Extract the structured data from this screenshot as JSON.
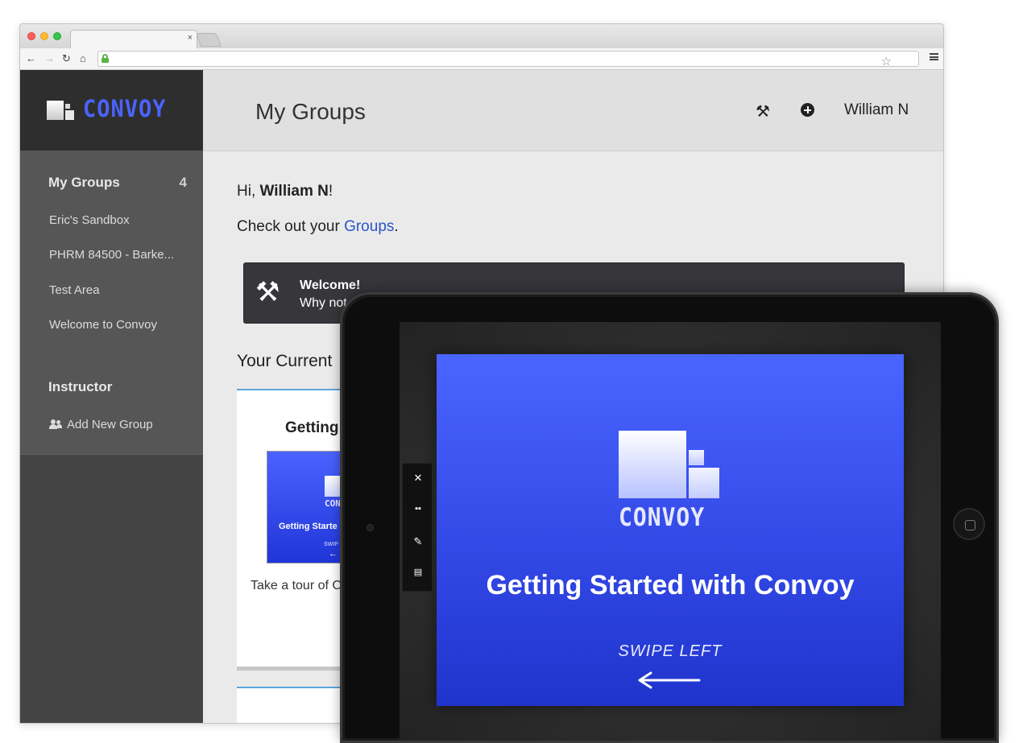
{
  "browser": {
    "tab_close": "×",
    "nav": {
      "back": "←",
      "forward": "→",
      "reload": "↻",
      "home": "⌂"
    },
    "star": "☆",
    "icons": [
      "lock-icon",
      "star-icon",
      "menu-icon"
    ]
  },
  "sidebar": {
    "brand": "CONVOY",
    "groups_heading": "My Groups",
    "groups_count": "4",
    "groups": [
      "Eric's Sandbox",
      "PHRM 84500 - Barke...",
      "Test Area",
      "Welcome to Convoy"
    ],
    "instructor_heading": "Instructor",
    "add_group": "Add New Group"
  },
  "header": {
    "title": "My Groups",
    "user": "William N",
    "icons": [
      "tools-icon",
      "plus-circle-icon"
    ]
  },
  "content": {
    "greeting_prefix": "Hi, ",
    "greeting_name": "William N",
    "greeting_suffix": "!",
    "checkout_prefix": "Check out your ",
    "checkout_link": "Groups",
    "checkout_suffix": ".",
    "welcome_title": "Welcome!",
    "welcome_text": "Why not",
    "current_heading": "Your Current",
    "card": {
      "title": "Getting",
      "thumb_name": "CONV",
      "thumb_title": "Getting Starte",
      "thumb_swipe": "SWIP",
      "thumb_arrow": "←",
      "desc": "Take a tour of C"
    }
  },
  "tablet": {
    "slide_name": "CONVOY",
    "slide_title": "Getting Started with Convoy",
    "swipe": "SWIPE LEFT",
    "toolbar_close": "✕"
  },
  "colors": {
    "brand": "#4a63ff",
    "link": "#2a55c8",
    "sidebar_bg": "#444444"
  }
}
